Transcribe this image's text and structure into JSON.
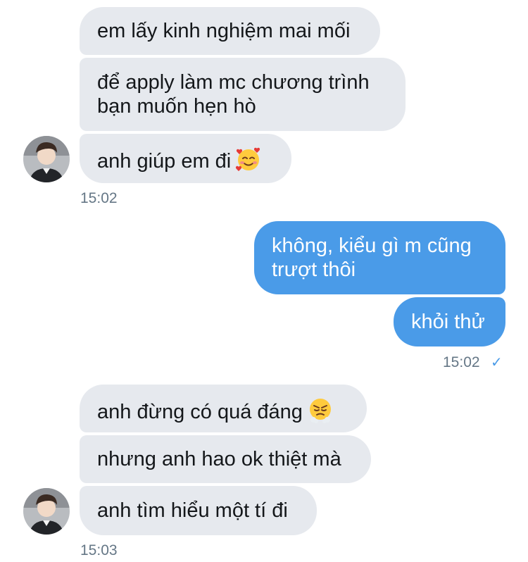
{
  "conversation": {
    "group1": {
      "messages": [
        "em lấy kinh nghiệm mai mối",
        "để apply làm mc chương trình",
        "bạn muốn hẹn hò",
        "anh giúp em đi"
      ],
      "emoji": "smiling-face-with-hearts",
      "time": "15:02"
    },
    "group2": {
      "messages": [
        "không, kiểu gì m cũng",
        "trượt thôi",
        "khỏi thử"
      ],
      "time": "15:02",
      "status": "✓"
    },
    "group3": {
      "messages": [
        "anh đừng có quá đáng",
        "nhưng anh hao ok thiệt mà",
        "anh tìm hiểu một tí đi"
      ],
      "emoji": "face-with-steam-from-nose",
      "time": "15:03"
    }
  },
  "colors": {
    "incoming_bubble": "#e6e9ee",
    "outgoing_bubble": "#4a9be8",
    "timestamp": "#657786",
    "read_check": "#4a9be8"
  }
}
